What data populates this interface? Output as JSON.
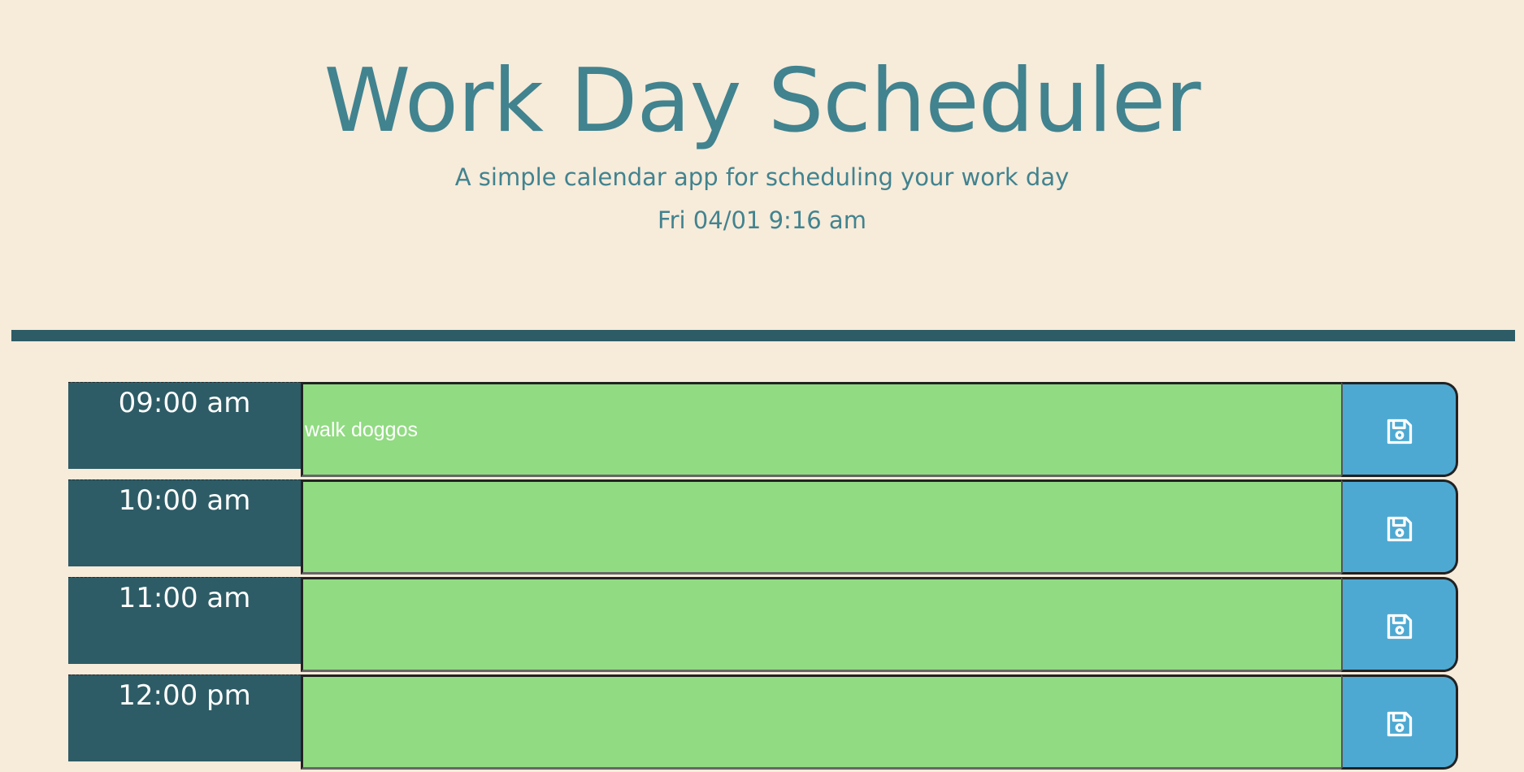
{
  "header": {
    "title": "Work Day Scheduler",
    "subtitle": "A simple calendar app for scheduling your work day",
    "current_datetime": "Fri 04/01 9:16 am"
  },
  "colors": {
    "background": "#f7ebda",
    "title": "#41838f",
    "divider": "#2d5c66",
    "hour_block": "#2d5c66",
    "future_row": "#91db82",
    "save_button": "#4ea9d2"
  },
  "rows": [
    {
      "hour": "09:00 am",
      "description": "walk doggos",
      "save_icon": "floppy-disk-icon"
    },
    {
      "hour": "10:00 am",
      "description": "",
      "save_icon": "floppy-disk-icon"
    },
    {
      "hour": "11:00 am",
      "description": "",
      "save_icon": "floppy-disk-icon"
    },
    {
      "hour": "12:00 pm",
      "description": "",
      "save_icon": "floppy-disk-icon"
    }
  ]
}
